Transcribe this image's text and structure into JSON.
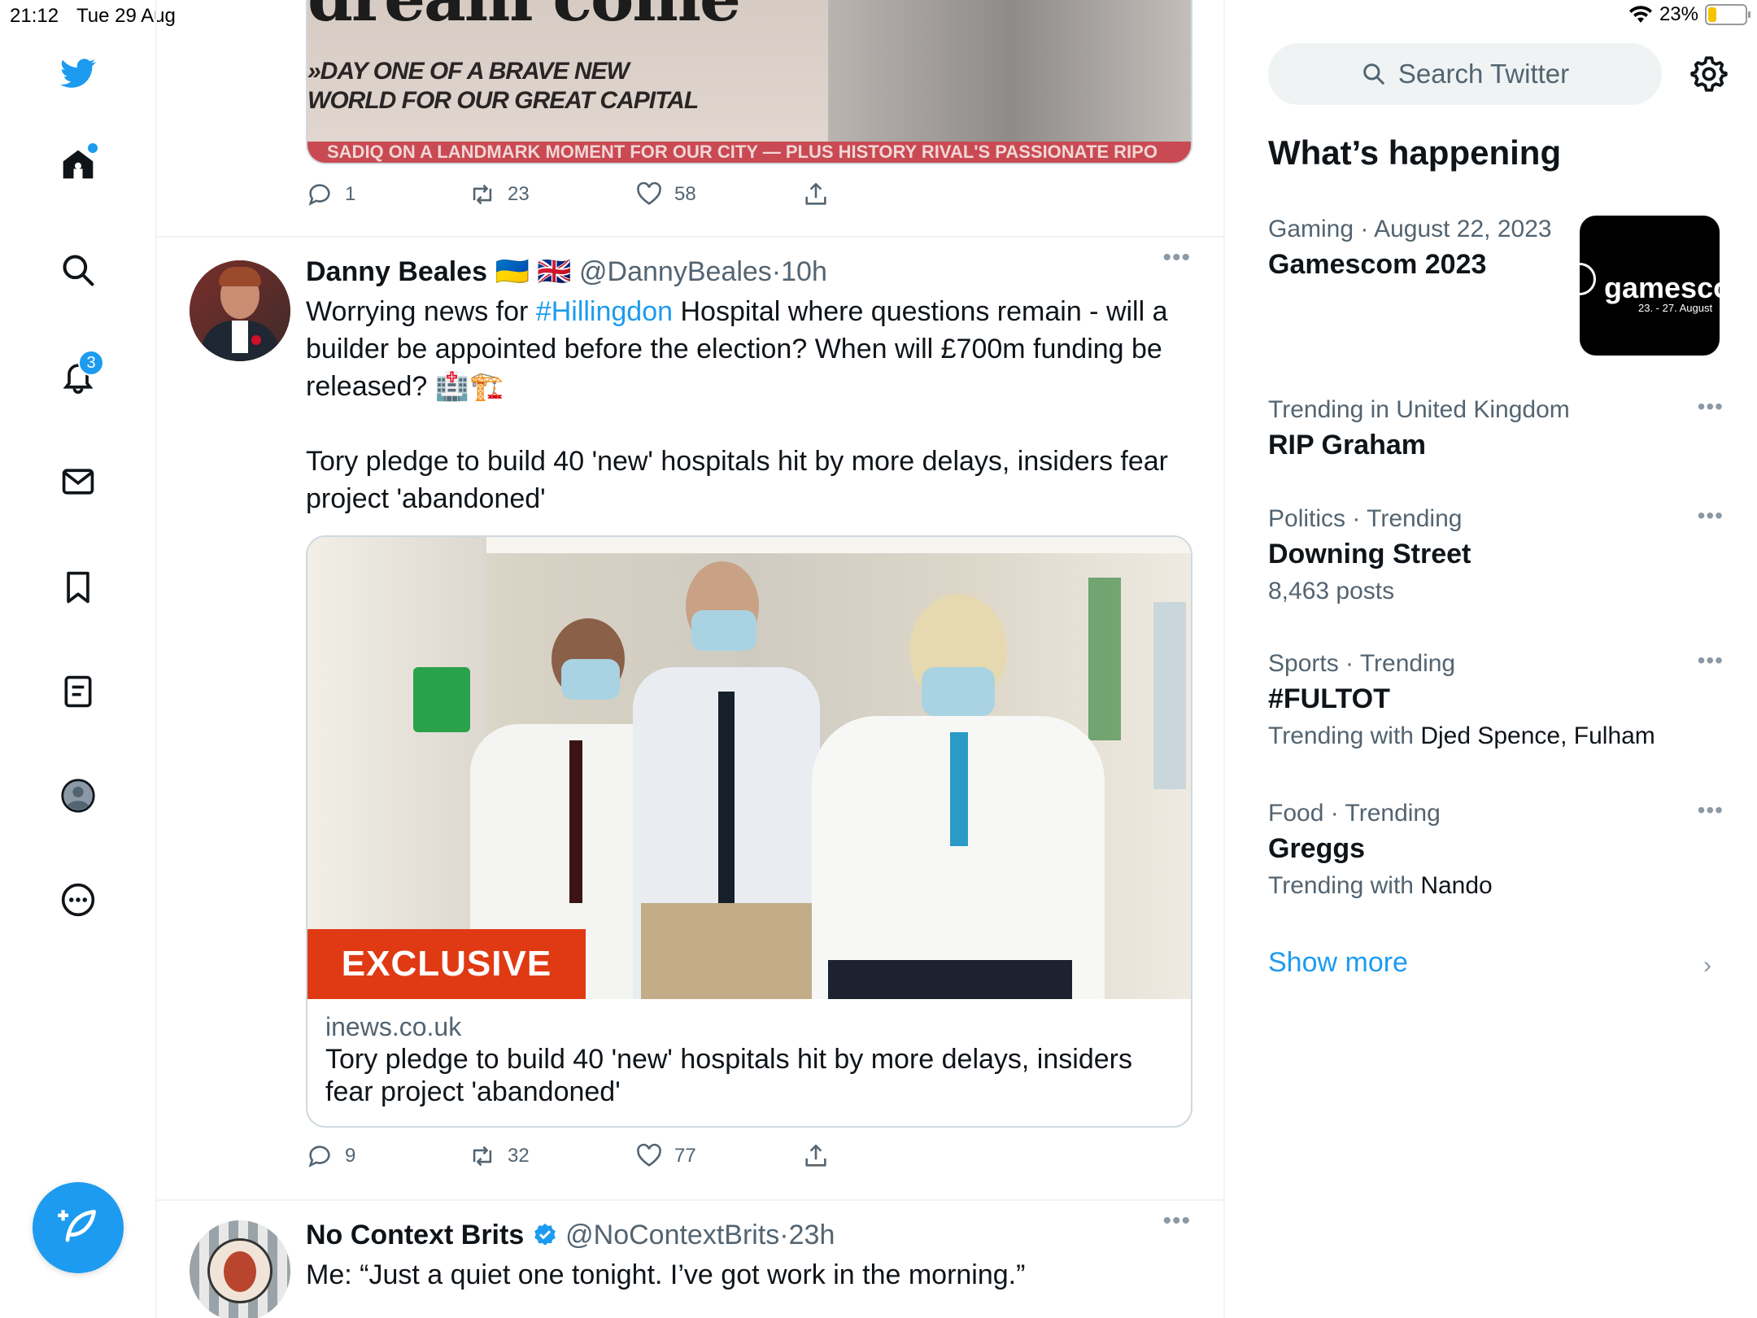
{
  "status_bar": {
    "time": "21:12",
    "date": "Tue 29 Aug",
    "battery": "23%",
    "battery_level": 0.23
  },
  "nav": {
    "notifications_count": "3",
    "items": [
      "twitter-logo",
      "home-icon",
      "search-icon",
      "bell-icon",
      "mail-icon",
      "bookmark-icon",
      "lists-icon",
      "profile-icon",
      "more-icon"
    ]
  },
  "feed": {
    "top_tweet": {
      "newspaper_line1": "»DAY ONE OF A BRAVE NEW",
      "newspaper_line2": "WORLD FOR OUR GREAT CAPITAL",
      "newspaper_strip": "SADIQ ON A LANDMARK MOMENT FOR OUR CITY — PLUS HISTORY RIVAL'S PASSIONATE RIPO",
      "replies": "1",
      "retweets": "23",
      "likes": "58"
    },
    "tweet1": {
      "name": "Danny Beales",
      "flags": "🇺🇦 🇬🇧",
      "handle": "@DannyBeales",
      "time": "10h",
      "text_before": "Worrying news for ",
      "hashtag": "#Hillingdon",
      "text_after": " Hospital where questions remain - will a builder be appointed before the election? When will £700m funding be released? 🏥🏗️",
      "text_para2": "Tory pledge to build 40 'new' hospitals hit by more delays, insiders fear project 'abandoned'",
      "card": {
        "badge": "EXCLUSIVE",
        "domain": "inews.co.uk",
        "title": "Tory pledge to build 40 'new' hospitals hit by more delays, insiders fear project 'abandoned'"
      },
      "replies": "9",
      "retweets": "32",
      "likes": "77"
    },
    "tweet2": {
      "name": "No Context Brits",
      "handle": "@NoContextBrits",
      "time": "23h",
      "text": "Me: “Just a quiet one tonight. I’ve got work in the morning.”"
    }
  },
  "sidebar": {
    "search_placeholder": "Search Twitter",
    "section_title": "What’s happening",
    "trends": [
      {
        "category": "Gaming",
        "date": "August 22, 2023",
        "title": "Gamescom 2023",
        "image_text": "gamescom",
        "image_subtext": "23. - 27. August"
      },
      {
        "category": "Trending in United Kingdom",
        "title": "RIP Graham"
      },
      {
        "category": "Politics · Trending",
        "title": "Downing Street",
        "sub": "8,463 posts"
      },
      {
        "category": "Sports · Trending",
        "title": "#FULTOT",
        "sub_prefix": "Trending with ",
        "sub_value": "Djed Spence, Fulham"
      },
      {
        "category": "Food · Trending",
        "title": "Greggs",
        "sub_prefix": "Trending with ",
        "sub_value": "Nando"
      }
    ],
    "show_more": "Show more"
  },
  "colors": {
    "accent": "#1d9bf0",
    "text": "#0f1419",
    "muted": "#536471",
    "exclusive": "#e03a14"
  }
}
